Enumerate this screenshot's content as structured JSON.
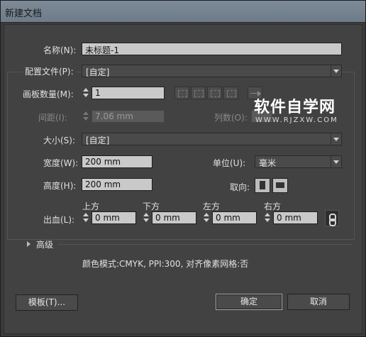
{
  "window": {
    "title": "新建文档"
  },
  "name": {
    "label": "名称(N):",
    "value": "未标题-1"
  },
  "profile": {
    "label": "配置文件(P):",
    "value": "[自定]"
  },
  "artboards": {
    "count_label": "画板数量(M):",
    "count_value": "1",
    "spacing_label": "间距(I):",
    "spacing_value": "7.06 mm",
    "columns_label": "列数(O):"
  },
  "size": {
    "label": "大小(S):",
    "value": "[自定]"
  },
  "width": {
    "label": "宽度(W):",
    "value": "200 mm"
  },
  "height": {
    "label": "高度(H):",
    "value": "200 mm"
  },
  "units": {
    "label": "单位(U):",
    "value": "毫米"
  },
  "orientation": {
    "label": "取向:"
  },
  "bleed": {
    "label": "出血(L):",
    "top_label": "上方",
    "top_value": "0 mm",
    "bottom_label": "下方",
    "bottom_value": "0 mm",
    "left_label": "左方",
    "left_value": "0 mm",
    "right_label": "右方",
    "right_value": "0 mm"
  },
  "advanced": {
    "label": "高级"
  },
  "info": {
    "text": "颜色模式:CMYK, PPI:300, 对齐像素网格:否"
  },
  "buttons": {
    "templates": "模板(T)...",
    "ok": "确定",
    "cancel": "取消"
  },
  "watermark": {
    "title": "软件自学网",
    "url": "WWW.RJZXW.COM"
  }
}
